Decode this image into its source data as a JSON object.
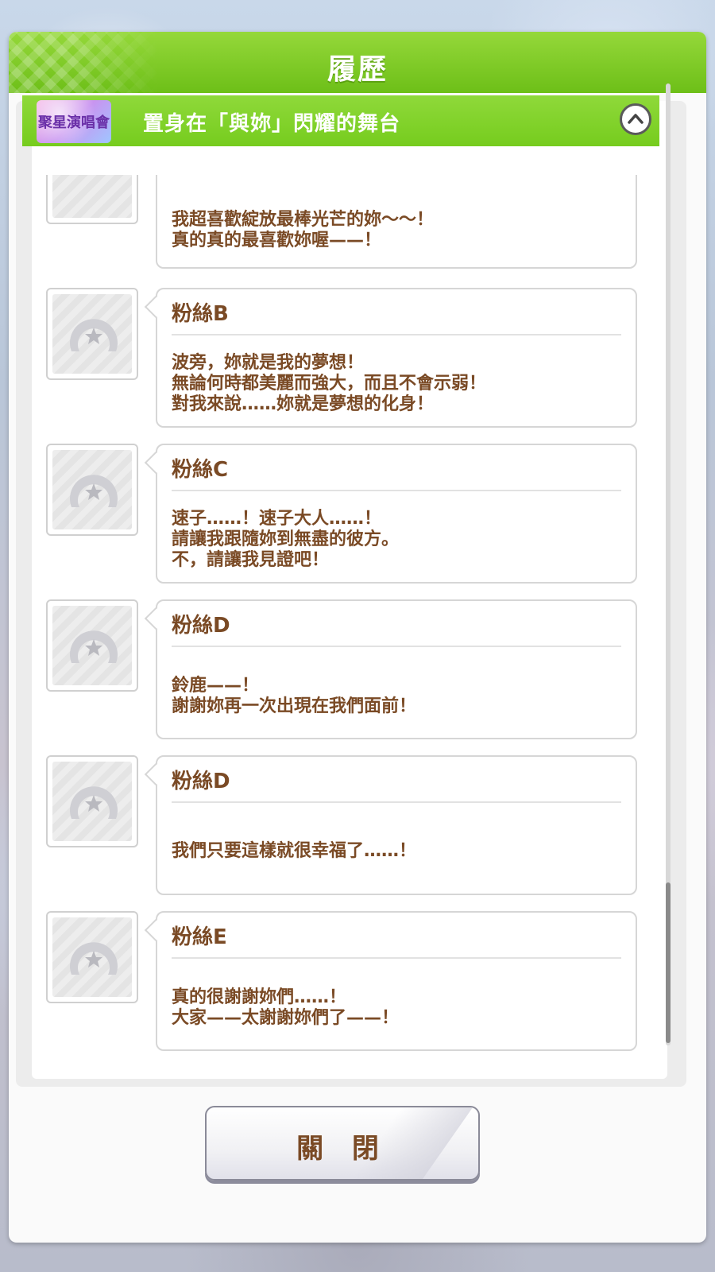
{
  "dialog": {
    "title": "履歷",
    "close_label": "關 閉"
  },
  "section": {
    "logo_text": "聚星演唱會",
    "title": "置身在「與妳」閃耀的舞台",
    "toggle_icon": "chevron-up-icon"
  },
  "entries": [
    {
      "speaker": "",
      "lines": [
        "我超喜歡綻放最棒光芒的妳～～！",
        "真的真的最喜歡妳喔——！"
      ]
    },
    {
      "speaker": "粉絲B",
      "lines": [
        "波旁，妳就是我的夢想！",
        "無論何時都美麗而強大，而且不會示弱！",
        "對我來說……妳就是夢想的化身！"
      ]
    },
    {
      "speaker": "粉絲C",
      "lines": [
        "速子……！速子大人……！",
        "請讓我跟隨妳到無盡的彼方。",
        "不，請讓我見證吧！"
      ]
    },
    {
      "speaker": "粉絲D",
      "lines": [
        "鈴鹿——！",
        "謝謝妳再一次出現在我們面前！"
      ]
    },
    {
      "speaker": "粉絲D",
      "lines": [
        "我們只要這樣就很幸福了……！"
      ]
    },
    {
      "speaker": "粉絲E",
      "lines": [
        "真的很謝謝妳們……！",
        "大家——太謝謝妳們了——！"
      ]
    }
  ],
  "colors": {
    "header_green": "#7ccc20",
    "text_brown": "#7a4a25"
  }
}
